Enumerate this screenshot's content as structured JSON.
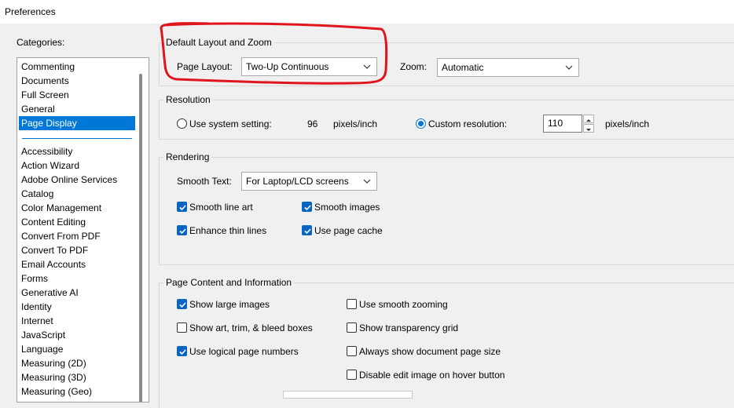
{
  "window": {
    "title": "Preferences"
  },
  "categories": {
    "label": "Categories:",
    "selected": "Page Display",
    "top_items": [
      "Commenting",
      "Documents",
      "Full Screen",
      "General",
      "Page Display"
    ],
    "items": [
      "Accessibility",
      "Action Wizard",
      "Adobe Online Services",
      "Catalog",
      "Color Management",
      "Content Editing",
      "Convert From PDF",
      "Convert To PDF",
      "Email Accounts",
      "Forms",
      "Generative AI",
      "Identity",
      "Internet",
      "JavaScript",
      "Language",
      "Measuring (2D)",
      "Measuring (3D)",
      "Measuring (Geo)"
    ]
  },
  "layout_zoom": {
    "title": "Default Layout and Zoom",
    "page_layout_label": "Page Layout:",
    "page_layout_value": "Two-Up Continuous",
    "zoom_label": "Zoom:",
    "zoom_value": "Automatic"
  },
  "resolution": {
    "title": "Resolution",
    "system_label": "Use system setting:",
    "system_value": "96",
    "system_unit": "pixels/inch",
    "custom_label": "Custom resolution:",
    "custom_value": "110",
    "custom_unit": "pixels/inch",
    "selected": "custom"
  },
  "rendering": {
    "title": "Rendering",
    "smooth_text_label": "Smooth Text:",
    "smooth_text_value": "For Laptop/LCD screens",
    "smooth_line_art": "Smooth line art",
    "smooth_images": "Smooth images",
    "enhance_thin_lines": "Enhance thin lines",
    "use_page_cache": "Use page cache"
  },
  "page_content": {
    "title": "Page Content and Information",
    "show_large_images": "Show large images",
    "show_art_trim": "Show art, trim, & bleed boxes",
    "use_logical_page_numbers": "Use logical page numbers",
    "use_smooth_zooming": "Use smooth zooming",
    "show_transparency_grid": "Show transparency grid",
    "always_show_doc_size": "Always show document page size",
    "disable_edit_image_hover": "Disable edit image on hover button"
  },
  "colors": {
    "accent": "#0078d7",
    "annotation": "#e0141c"
  }
}
